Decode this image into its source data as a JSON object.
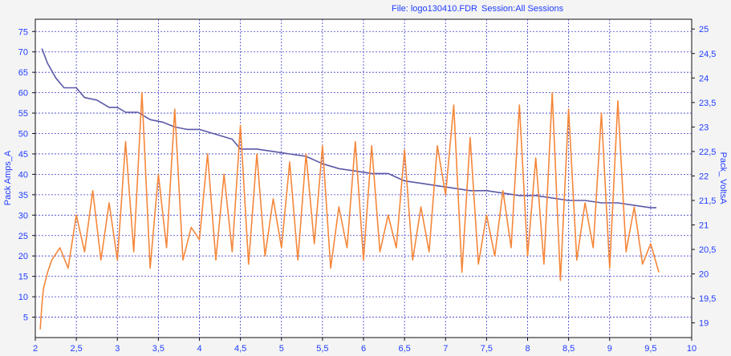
{
  "header": {
    "file_label": "File: logo130410.FDR",
    "session_label": "Session:All Sessions"
  },
  "chart_data": {
    "type": "line",
    "title": "",
    "xlabel": "",
    "ylabel_left": "Pack Amps_A",
    "ylabel_right": "Pack_ VoltsA",
    "grid": true,
    "xlim": [
      2.0,
      10.0
    ],
    "ylim_left": [
      0,
      78
    ],
    "ylim_right": [
      18.7,
      25.2
    ],
    "x_ticks": [
      2,
      2.5,
      3,
      3.5,
      4,
      4.5,
      5,
      5.5,
      6,
      6.5,
      7,
      7.5,
      8,
      8.5,
      9,
      9.5,
      10
    ],
    "x_tick_labels": [
      "2",
      "2,5",
      "3",
      "3,5",
      "4",
      "4,5",
      "5",
      "5,5",
      "6",
      "6,5",
      "7",
      "7,5",
      "8",
      "8,5",
      "9",
      "9,5",
      "10"
    ],
    "y_left_ticks": [
      5,
      10,
      15,
      20,
      25,
      30,
      35,
      40,
      45,
      50,
      55,
      60,
      65,
      70,
      75
    ],
    "y_left_tick_labels": [
      "5",
      "10",
      "15",
      "20",
      "25",
      "30",
      "35",
      "40",
      "45",
      "50",
      "55",
      "60",
      "65",
      "70",
      "75"
    ],
    "y_right_ticks": [
      19,
      19.5,
      20,
      20.5,
      21,
      21.5,
      22,
      22.5,
      23,
      23.5,
      24,
      24.5,
      25
    ],
    "y_right_tick_labels": [
      "19",
      "19,5",
      "20",
      "20,5",
      "21",
      "21,5",
      "22",
      "22,5",
      "23",
      "23,5",
      "24",
      "24,5",
      "25"
    ],
    "series": [
      {
        "name": "Pack_ VoltsA",
        "axis": "right",
        "color": "#5b58a6",
        "x": [
          2.08,
          2.15,
          2.25,
          2.35,
          2.5,
          2.6,
          2.75,
          2.9,
          3.0,
          3.1,
          3.25,
          3.4,
          3.55,
          3.7,
          3.85,
          4.0,
          4.2,
          4.4,
          4.5,
          4.7,
          4.9,
          5.1,
          5.3,
          5.5,
          5.7,
          5.9,
          6.1,
          6.3,
          6.5,
          6.7,
          6.9,
          7.1,
          7.3,
          7.5,
          7.7,
          7.9,
          8.1,
          8.3,
          8.5,
          8.7,
          8.9,
          9.1,
          9.3,
          9.5,
          9.57
        ],
        "values": [
          24.6,
          24.3,
          24.0,
          23.8,
          23.8,
          23.6,
          23.55,
          23.4,
          23.4,
          23.3,
          23.3,
          23.15,
          23.1,
          23.0,
          22.95,
          22.95,
          22.85,
          22.75,
          22.55,
          22.55,
          22.5,
          22.45,
          22.4,
          22.25,
          22.15,
          22.1,
          22.05,
          22.05,
          21.9,
          21.85,
          21.8,
          21.75,
          21.7,
          21.7,
          21.65,
          21.6,
          21.6,
          21.55,
          21.5,
          21.5,
          21.45,
          21.45,
          21.4,
          21.35,
          21.35
        ]
      },
      {
        "name": "Pack Amps_A",
        "axis": "left",
        "color": "#f5873a",
        "x": [
          2.06,
          2.08,
          2.1,
          2.15,
          2.2,
          2.3,
          2.4,
          2.5,
          2.6,
          2.7,
          2.8,
          2.9,
          3.0,
          3.1,
          3.2,
          3.3,
          3.4,
          3.5,
          3.6,
          3.7,
          3.8,
          3.9,
          4.0,
          4.1,
          4.2,
          4.3,
          4.4,
          4.5,
          4.6,
          4.7,
          4.8,
          4.9,
          5.0,
          5.1,
          5.2,
          5.3,
          5.4,
          5.5,
          5.6,
          5.7,
          5.8,
          5.9,
          6.0,
          6.1,
          6.2,
          6.3,
          6.4,
          6.5,
          6.6,
          6.7,
          6.8,
          6.9,
          7.0,
          7.1,
          7.2,
          7.3,
          7.4,
          7.5,
          7.6,
          7.7,
          7.8,
          7.9,
          8.0,
          8.1,
          8.2,
          8.3,
          8.4,
          8.5,
          8.6,
          8.7,
          8.8,
          8.9,
          9.0,
          9.1,
          9.2,
          9.3,
          9.4,
          9.5,
          9.6
        ],
        "values": [
          2,
          8,
          12,
          16,
          19,
          22,
          17,
          30,
          21,
          36,
          19,
          33,
          19,
          48,
          21,
          60,
          17,
          40,
          22,
          56,
          19,
          27,
          24,
          45,
          19,
          40,
          21,
          52,
          18,
          45,
          20,
          34,
          22,
          43,
          19,
          45,
          23,
          47,
          17,
          32,
          22,
          48,
          19,
          47,
          21,
          30,
          22,
          46,
          19,
          32,
          21,
          47,
          35,
          57,
          16,
          49,
          18,
          30,
          20,
          36,
          22,
          57,
          20,
          44,
          18,
          60,
          14,
          56,
          19,
          33,
          22,
          55,
          17,
          58,
          21,
          32,
          18,
          23,
          16
        ]
      }
    ]
  }
}
